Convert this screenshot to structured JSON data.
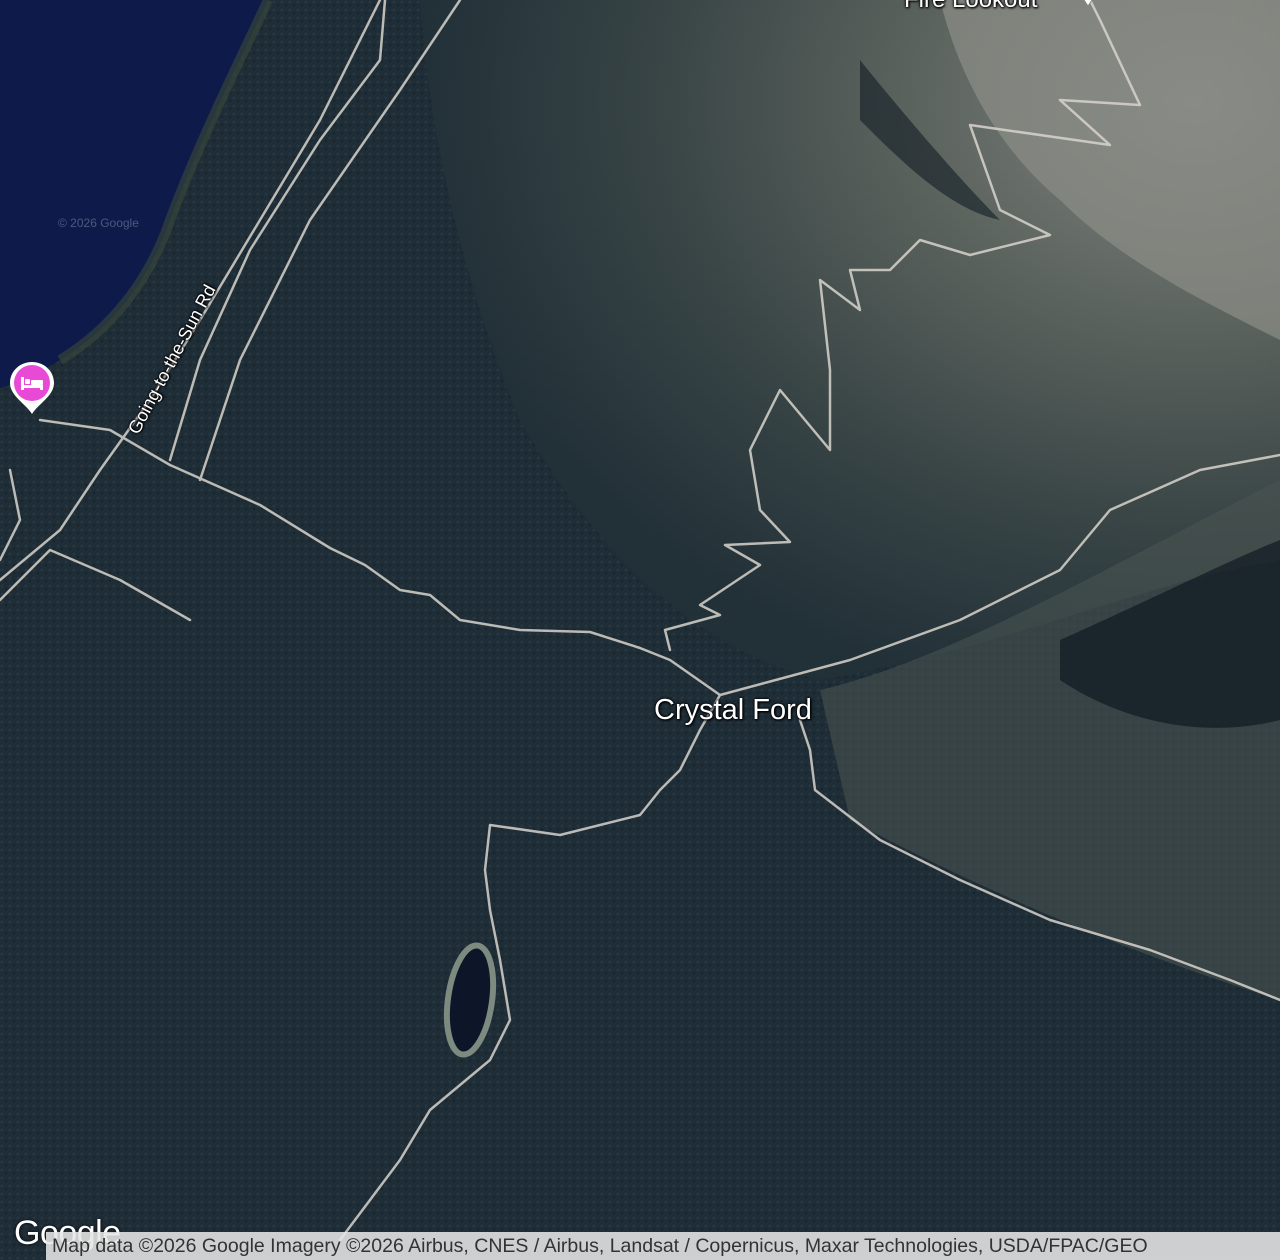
{
  "map": {
    "type": "satellite",
    "place_label": "Crystal Ford",
    "poi_label": "Fire Lookout",
    "road_label": "Going-to-the-Sun Rd",
    "watermark": "© 2026 Google",
    "logo": "Google",
    "attribution": "Map data ©2026 Google Imagery ©2026 Airbus, CNES / Airbus, Landsat / Copernicus, Maxar Technologies, USDA/FPAC/GEO"
  },
  "markers": [
    {
      "name": "lodging",
      "icon": "bed-icon",
      "color": "#e84ad6"
    },
    {
      "name": "fire-lookout",
      "icon": "pin-icon",
      "color": "#ffffff"
    }
  ],
  "colors": {
    "lake": "#0d1a4a",
    "forest": "#1e2c36",
    "mountain": "#7a8080",
    "trail": "#d8d4cc"
  }
}
